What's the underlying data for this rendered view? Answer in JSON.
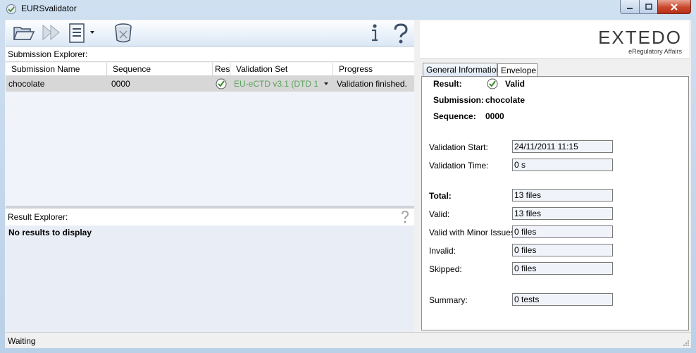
{
  "window": {
    "title": "EURSvalidator"
  },
  "colors": {
    "accent": "#5aa35a",
    "close_button": "#c9472d",
    "title_bar": "#cfe0f1"
  },
  "toolbar": {
    "icons": [
      "folder-open-icon",
      "play-icon",
      "report-icon",
      "dropdown-arrow-icon",
      "database-icon",
      "info-icon",
      "help-icon"
    ]
  },
  "submission_explorer": {
    "title": "Submission Explorer:",
    "columns": [
      "Submission Name",
      "Sequence",
      "Result",
      "Validation Set",
      "Progress"
    ],
    "rows": [
      {
        "name": "chocolate",
        "sequence": "0000",
        "result": "check-icon",
        "validation_set": "EU-eCTD v3.1 (DTD 1...",
        "progress": "Validation finished."
      }
    ]
  },
  "result_explorer": {
    "title": "Result Explorer:",
    "empty_text": "No results to display"
  },
  "logo": {
    "name": "EXTEDO",
    "tagline": "eRegulatory Affairs"
  },
  "tabs": [
    "General Information",
    "Envelope"
  ],
  "general_info": {
    "result_label": "Result:",
    "result_value": "Valid",
    "submission_label": "Submission:",
    "submission_value": "chocolate",
    "sequence_label": "Sequence:",
    "sequence_value": "0000",
    "fields": [
      {
        "label": "Validation Start:",
        "value": "24/11/2011 11:15"
      },
      {
        "label": "Validation Time:",
        "value": "0 s"
      },
      {
        "label": "Total:",
        "value": "13 files"
      },
      {
        "label": "Valid:",
        "value": "13 files"
      },
      {
        "label": "Valid with Minor Issues:",
        "value": "0 files"
      },
      {
        "label": "Invalid:",
        "value": "0 files"
      },
      {
        "label": "Skipped:",
        "value": "0 files"
      },
      {
        "label": "Summary:",
        "value": "0 tests"
      }
    ]
  },
  "status": {
    "text": "Waiting"
  }
}
